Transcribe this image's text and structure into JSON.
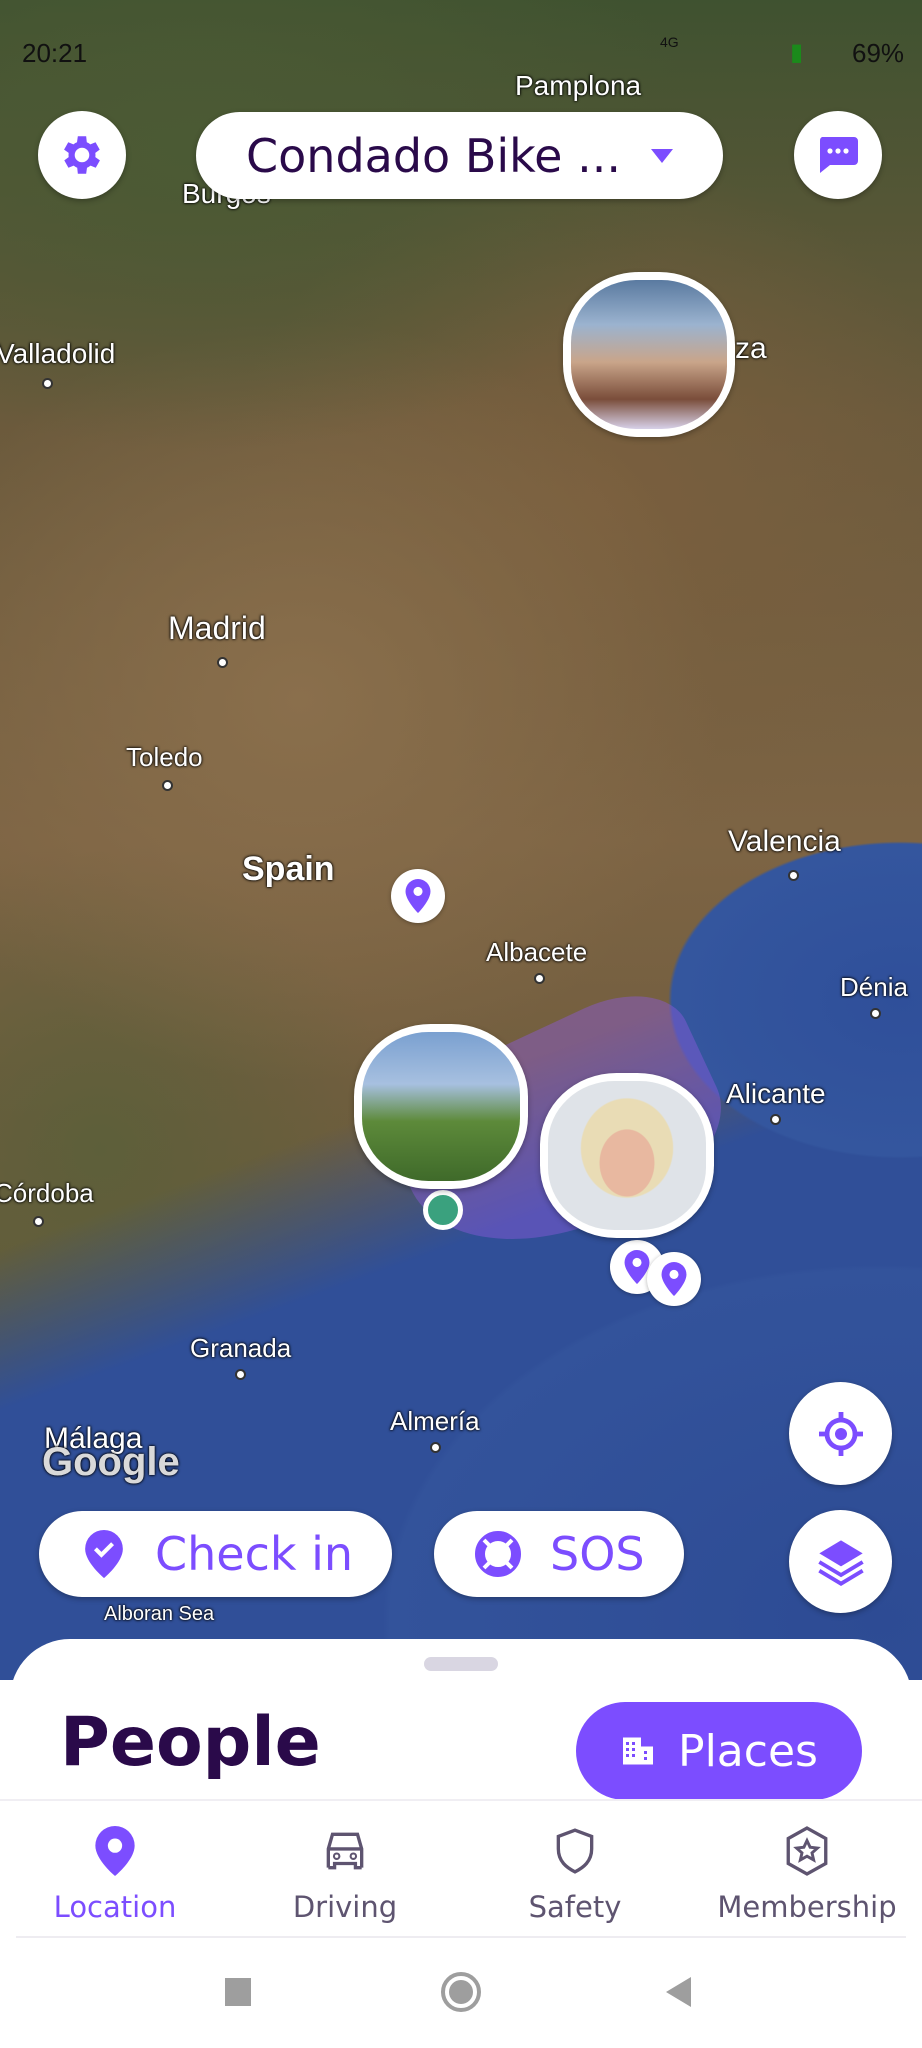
{
  "status_bar": {
    "time": "20:21",
    "battery": "69%",
    "network": "4G"
  },
  "header": {
    "group_name": "Condado Bike ...",
    "settings_icon": "gear-icon",
    "chat_icon": "chat-bubble-icon"
  },
  "map": {
    "labels": [
      "Pamplona",
      "Burgos",
      "Valladolid",
      "Madrid",
      "Toledo",
      "Spain",
      "Valencia",
      "Albacete",
      "Dénia",
      "Alicante",
      "Córdoba",
      "Granada",
      "Almería",
      "Málaga",
      "Alboran Sea",
      "za"
    ],
    "attribution": "Google"
  },
  "actions": {
    "check_in": "Check in",
    "sos": "SOS"
  },
  "sheet": {
    "title": "People",
    "places_button": "Places"
  },
  "bottom_nav": [
    {
      "label": "Location",
      "icon": "location-pin-icon",
      "active": true
    },
    {
      "label": "Driving",
      "icon": "car-icon"
    },
    {
      "label": "Safety",
      "icon": "shield-icon"
    },
    {
      "label": "Membership",
      "icon": "star-badge-icon"
    }
  ],
  "colors": {
    "accent": "#7c4dff",
    "title": "#2a0a4a",
    "inactive": "#5e5470"
  }
}
